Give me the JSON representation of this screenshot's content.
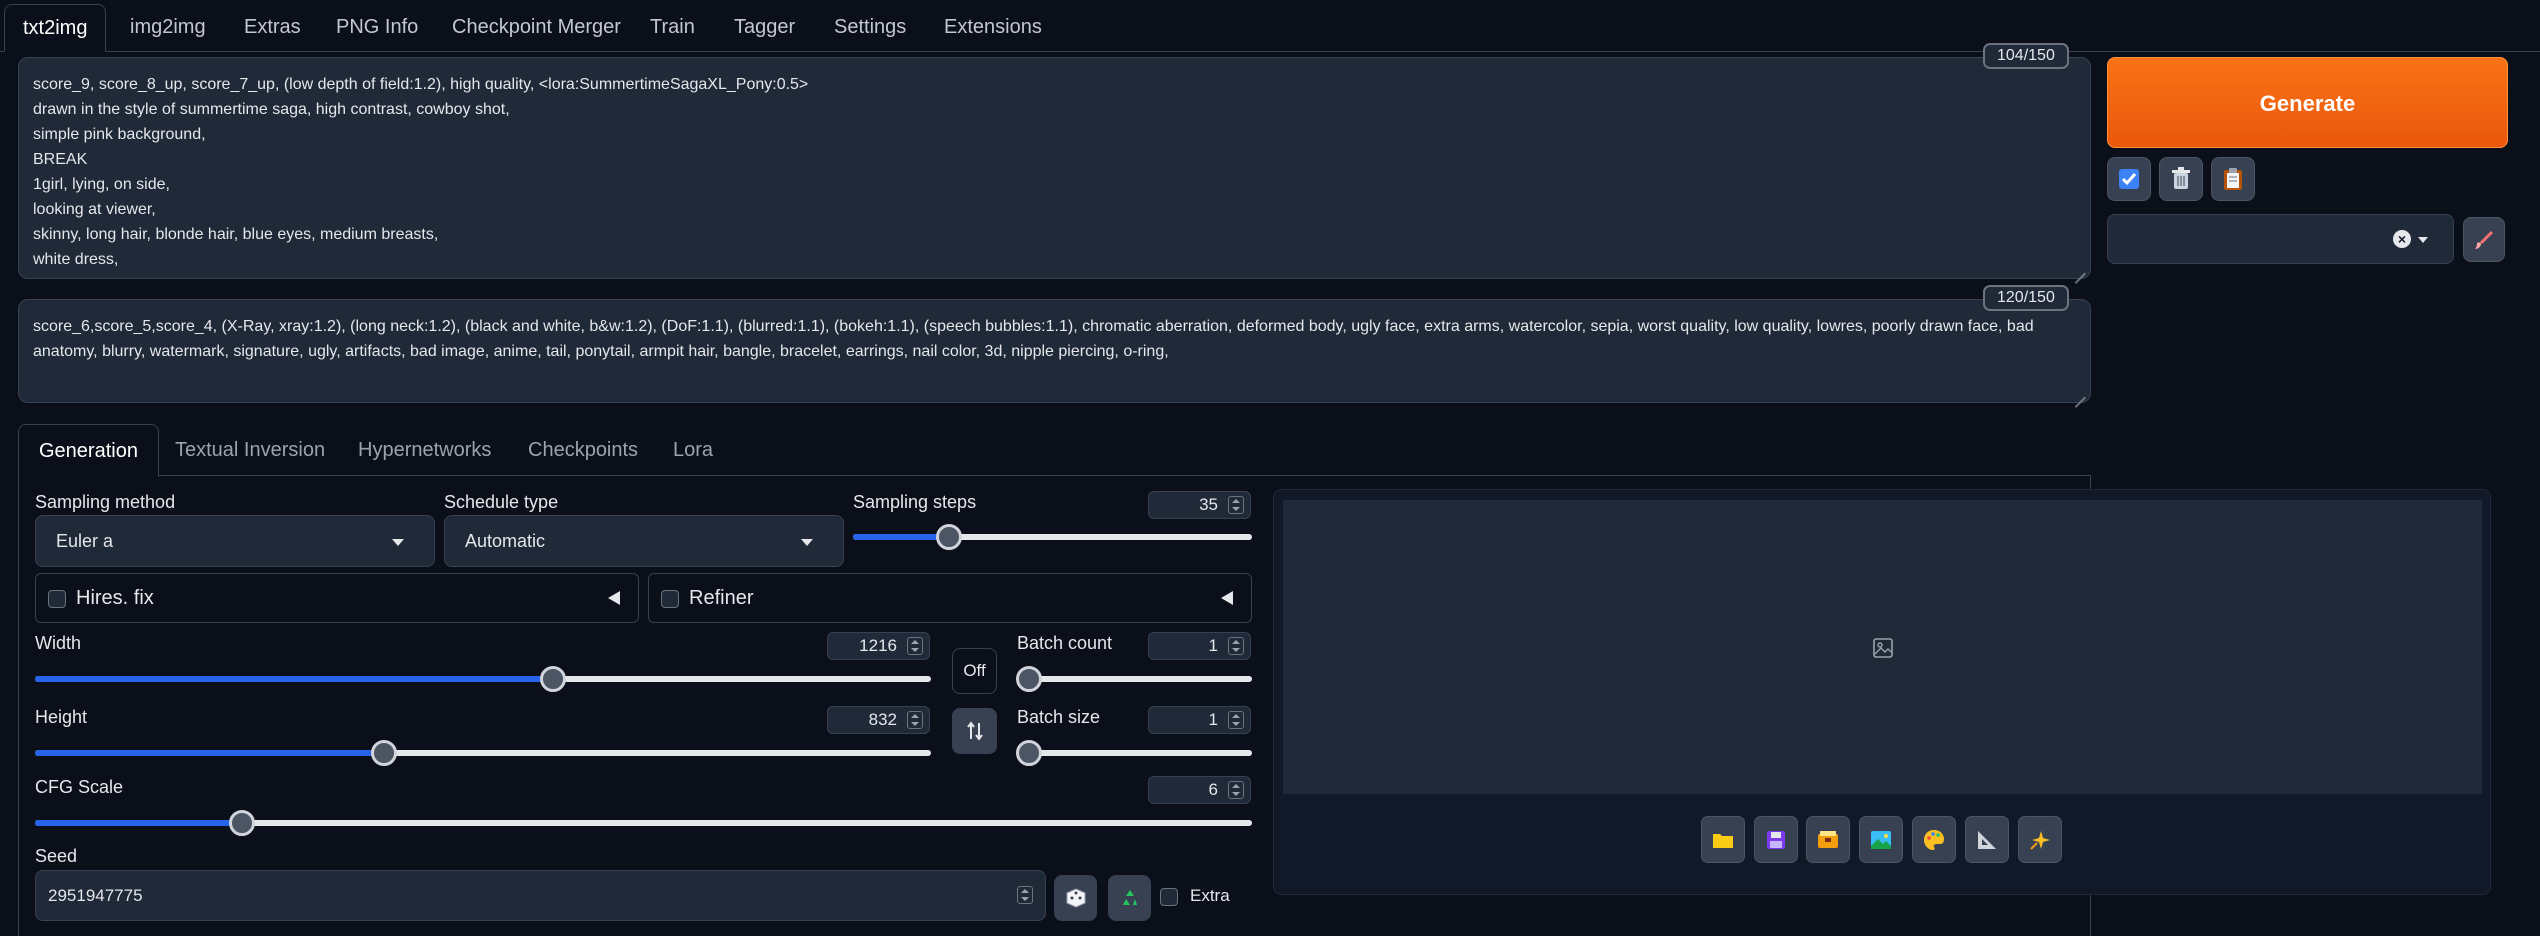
{
  "top_tabs": [
    "txt2img",
    "img2img",
    "Extras",
    "PNG Info",
    "Checkpoint Merger",
    "Train",
    "Tagger",
    "Settings",
    "Extensions"
  ],
  "positive": {
    "counter": "104/150",
    "text": "score_9, score_8_up, score_7_up, (low depth of field:1.2), high quality, <lora:SummertimeSagaXL_Pony:0.5>\ndrawn in the style of summertime saga, high contrast, cowboy shot,\nsimple pink background,\nBREAK\n1girl, lying, on side,\nlooking at viewer,\nskinny, long hair, blonde hair, blue eyes, medium breasts,\nwhite dress,"
  },
  "negative": {
    "counter": "120/150",
    "text": "score_6,score_5,score_4, (X-Ray, xray:1.2), (long neck:1.2), (black and white, b&w:1.2), (DoF:1.1), (blurred:1.1), (bokeh:1.1), (speech bubbles:1.1), chromatic aberration, deformed body, ugly face, extra arms, watercolor, sepia, worst quality, low quality, lowres, poorly drawn face, bad anatomy, blurry, watermark, signature, ugly, artifacts, bad image, anime, tail, ponytail, armpit hair, bangle, bracelet, earrings, nail color, 3d, nipple piercing, o-ring,"
  },
  "generate_label": "Generate",
  "sub_tabs": [
    "Generation",
    "Textual Inversion",
    "Hypernetworks",
    "Checkpoints",
    "Lora"
  ],
  "sampling_method": {
    "label": "Sampling method",
    "value": "Euler a"
  },
  "schedule_type": {
    "label": "Schedule type",
    "value": "Automatic"
  },
  "sampling_steps": {
    "label": "Sampling steps",
    "value": "35",
    "fraction": 0.24
  },
  "hires_fix": {
    "label": "Hires. fix"
  },
  "refiner": {
    "label": "Refiner"
  },
  "width": {
    "label": "Width",
    "value": "1216",
    "fraction": 0.578
  },
  "height": {
    "label": "Height",
    "value": "832",
    "fraction": 0.389
  },
  "aspect_button": "Off",
  "batch_count": {
    "label": "Batch count",
    "value": "1",
    "fraction": 0.0
  },
  "batch_size": {
    "label": "Batch size",
    "value": "1",
    "fraction": 0.0
  },
  "cfg_scale": {
    "label": "CFG Scale",
    "value": "6",
    "fraction": 0.17
  },
  "seed": {
    "label": "Seed",
    "value": "2951947775",
    "extra_label": "Extra"
  },
  "colors": {
    "accent": "#f97316",
    "slider_fill": "#2563eb",
    "background": "#0b0f19",
    "panel": "#1f2937"
  },
  "icons": {
    "tools": [
      "check-icon",
      "trash-icon",
      "clipboard-icon",
      "brush-icon",
      "clear-icon"
    ],
    "output": [
      "folder-icon",
      "save-icon",
      "zip-icon",
      "image-icon",
      "palette-icon",
      "ruler-icon",
      "sparkle-icon"
    ]
  }
}
